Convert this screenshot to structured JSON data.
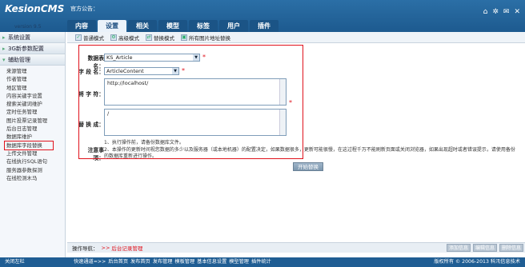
{
  "app": {
    "logo_name": "KesionCMS",
    "version": "version 9.5",
    "notice_label": "官方公告："
  },
  "nav": {
    "tabs": [
      {
        "label": "内容"
      },
      {
        "label": "设置"
      },
      {
        "label": "相关"
      },
      {
        "label": "模型"
      },
      {
        "label": "标签"
      },
      {
        "label": "用户"
      },
      {
        "label": "插件"
      }
    ],
    "icons": [
      "home-icon",
      "gear-icon",
      "mail-icon",
      "exit-icon"
    ]
  },
  "sidebar": {
    "sections": [
      {
        "label": "系统设置"
      },
      {
        "label": "3G新参数配置"
      },
      {
        "label": "辅助管理"
      }
    ],
    "items": [
      {
        "label": "来源管理"
      },
      {
        "label": "作者管理"
      },
      {
        "label": "地区管理"
      },
      {
        "label": "内容关键字设置"
      },
      {
        "label": "搜索关键词维护"
      },
      {
        "label": "定时任务管理"
      },
      {
        "label": "图片投票记录管理"
      },
      {
        "label": "后台日志管理"
      },
      {
        "label": "数据库维护"
      },
      {
        "label": "数据库字段替换"
      },
      {
        "label": "上传文件管理"
      },
      {
        "label": "在线执行SQL语句"
      },
      {
        "label": "服务器参数探测"
      },
      {
        "label": "在线检测木马"
      }
    ]
  },
  "toolbar": {
    "buttons": [
      {
        "label": "普通模式"
      },
      {
        "label": "高级模式"
      },
      {
        "label": "替换模式"
      },
      {
        "label": "所有图片地址替换"
      }
    ]
  },
  "form": {
    "table_label": "数据表名：",
    "table_value": "KS_Article",
    "field_label": "字 段 名：",
    "field_value": "ArticleContent",
    "find_label": "将 字 符：",
    "find_value": "http://localhost/",
    "replace_label": "替 换 成：",
    "replace_value": "/",
    "notes_label": "注意事项：",
    "notes": [
      "1、执行操作前，请备份数据库文件。",
      "2、本操作的更新时间视您数据的多少以及服务器（或本地机器）的配置决定，如果数据很多，更新可能很慢，在这过程千万不能刷新页面或关闭浏览器，如果出现超时或者错误提示，请使用备份的数据库重新进行操作。"
    ],
    "submit_label": "开始替换",
    "required_mark": "*"
  },
  "opbar": {
    "label": "操作导航：",
    "arrow": ">>",
    "crumb": "后台记录管理",
    "buttons": [
      {
        "label": "添加信息"
      },
      {
        "label": "编辑信息"
      },
      {
        "label": "删除信息"
      }
    ]
  },
  "footer": {
    "close_label": "关闭左栏",
    "quick_label": "快速通道=>>",
    "links": "后台首页  发布首页  发布管理  模板管理  基本信息设置  模型管理  插件统计",
    "copyright": "版权所有 © 2006-2013 科汛信息技术"
  },
  "colors": {
    "header_blue": "#1d5a8f",
    "highlight_red": "#e0121c"
  }
}
